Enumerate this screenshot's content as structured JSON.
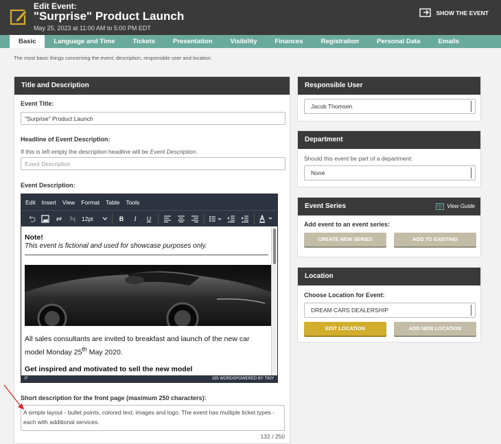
{
  "header": {
    "kicker": "Edit Event:",
    "title": "\"Surprise\" Product Launch",
    "date": "May 25, 2023 at 11:00 AM to 5:00 PM EDT",
    "show_event": "SHOW THE EVENT"
  },
  "tabs": [
    {
      "label": "Basic"
    },
    {
      "label": "Language and Time"
    },
    {
      "label": "Tickets"
    },
    {
      "label": "Presentation"
    },
    {
      "label": "Visibility"
    },
    {
      "label": "Finances"
    },
    {
      "label": "Registration"
    },
    {
      "label": "Personal Data"
    },
    {
      "label": "Emails"
    }
  ],
  "intro": "The most basic things concerning the event; description, responsible user and location.",
  "title_desc": {
    "heading": "Title and Description",
    "event_title_label": "Event Title:",
    "event_title_value": "\"Surprise\" Product Launch",
    "headline_label": "Headline of Event Description:",
    "headline_help_prefix": "If this is left empty the description headline will be ",
    "headline_help_em": "Event Description",
    "headline_help_suffix": ".",
    "headline_placeholder": "Event Description",
    "desc_label": "Event Description:",
    "short_label": "Short description for the front page (maximum 250 characters):",
    "short_value": "A simple layout - bullet points, colored text, images and logo. The event has multiple ticket types - each with additional services.",
    "counter": "132 / 250"
  },
  "editor": {
    "menu": [
      "Edit",
      "Insert",
      "View",
      "Format",
      "Table",
      "Tools"
    ],
    "font_size": "12pt",
    "note_title": "Note!",
    "note_sub": "This event is fictional and used for showcase purposes only.",
    "para_a": "All sales consultants are invited to breakfast and launch of the new car model Monday 25",
    "para_sup": "th",
    "para_b": " May 2020.",
    "para2": "Get inspired and motivated to sell the new model",
    "status_left": "P",
    "status_right": "155 WORDSPOWERED BY TINY"
  },
  "responsible": {
    "heading": "Responsible User",
    "value": "Jacob Thomsen"
  },
  "department": {
    "heading": "Department",
    "help": "Should this event be part of a department:",
    "value": "None"
  },
  "series": {
    "heading": "Event Series",
    "guide": "View Guide",
    "label": "Add event to an event series:",
    "create": "CREATE NEW SERIES",
    "add": "ADD TO EXISTING"
  },
  "location": {
    "heading": "Location",
    "label": "Choose Location for Event:",
    "value": "DREAM CARS DEALERSHIP",
    "edit": "EDIT LOCATION",
    "add_new": "ADD NEW LOCATION"
  },
  "colors": {
    "header_bg": "#3a3a3a",
    "tabs_bg": "#6aaa9c",
    "gold": "#d1ae2c",
    "tan": "#c3bda7"
  }
}
